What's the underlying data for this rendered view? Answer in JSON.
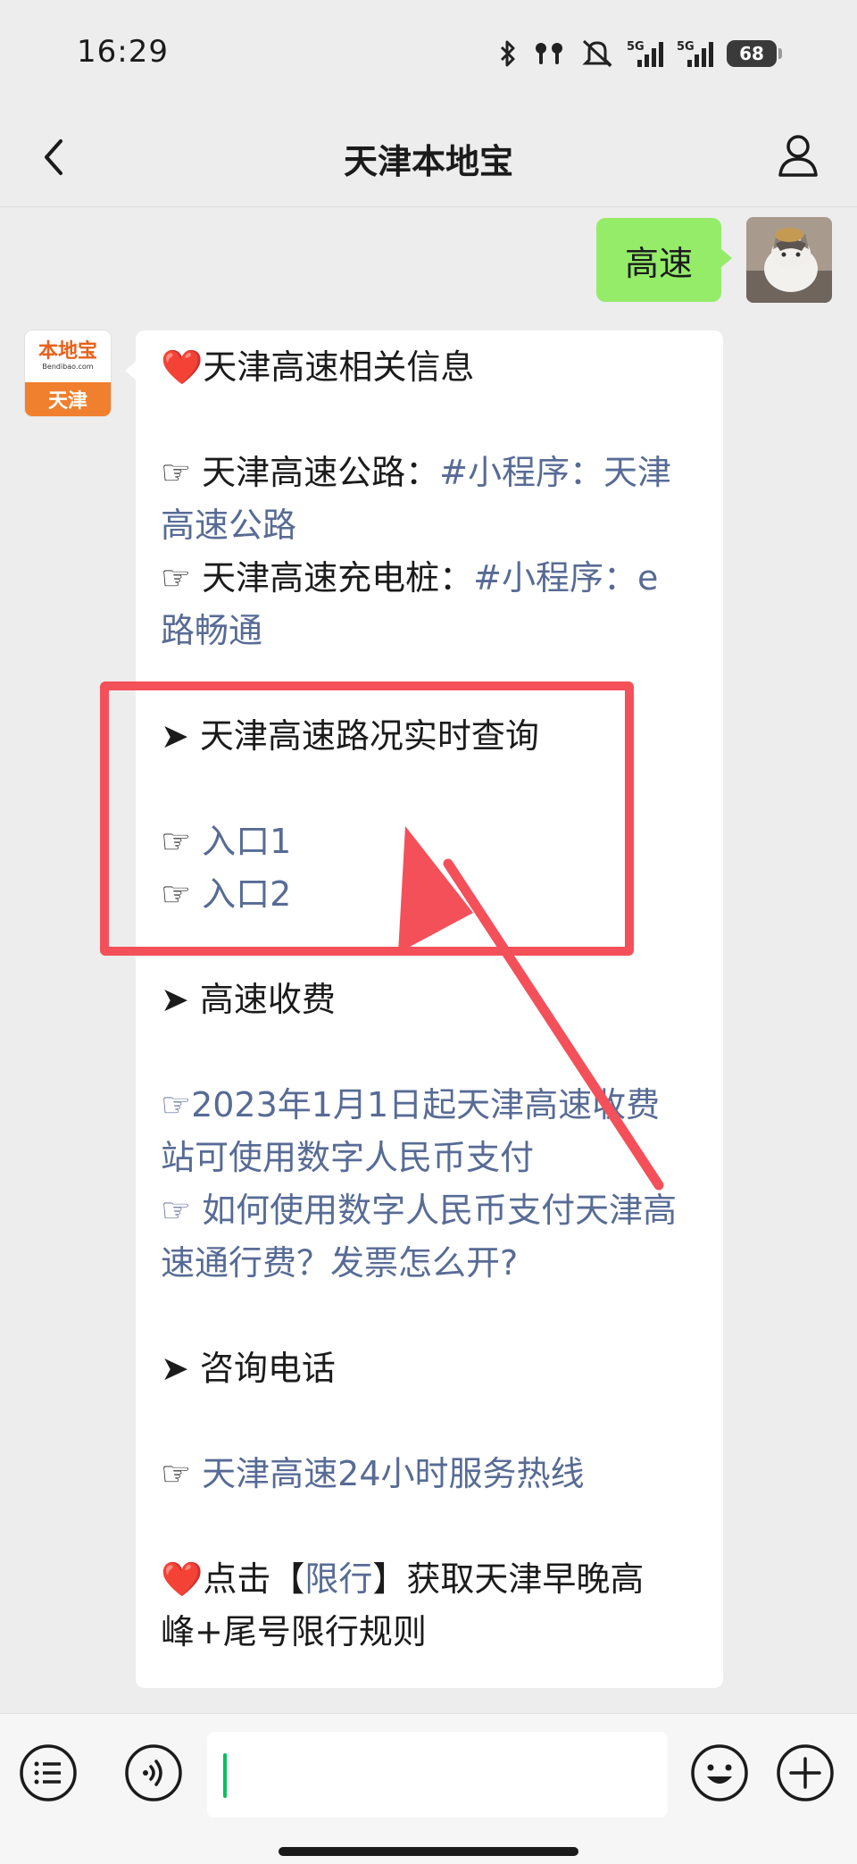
{
  "status_bar": {
    "time": "16:29",
    "signal_1": "5G",
    "signal_2": "5G",
    "battery": "68"
  },
  "nav": {
    "title": "天津本地宝"
  },
  "messages": {
    "outgoing_text": "高速",
    "bot_logo": "本地宝",
    "bot_url": "Bendibao.com",
    "bot_city": "天津"
  },
  "reply": {
    "title_heart": "❤️",
    "title": "天津高速相关信息",
    "road_prefix": "☞ 天津高速公路：",
    "road_link_1": "#小程序：天津",
    "road_link_2": "高速公路",
    "charger_prefix": "☞ 天津高速充电桩：",
    "charger_link_1": "#小程序：e",
    "charger_link_2": "路畅通",
    "section_traffic": "➤ 天津高速路况实时查询",
    "entry_1_icon": "☞",
    "entry_1": "入口1",
    "entry_2_icon": "☞",
    "entry_2": "入口2",
    "section_toll": "➤ 高速收费",
    "toll_link_1a": "☞2023年1月1日起天津高速收费",
    "toll_link_1b": "站可使用数字人民币支付",
    "toll_link_2a": "☞ 如何使用数字人民币支付天津高",
    "toll_link_2b": "速通行费？发票怎么开?",
    "section_phone": "➤ 咨询电话",
    "hotline_icon": "☞",
    "hotline": "天津高速24小时服务热线",
    "footer_heart": "❤️",
    "footer_a": "点击【",
    "footer_link": "限行",
    "footer_b": "】获取天津早晚高",
    "footer_c": "峰+尾号限行规则"
  },
  "colors": {
    "link": "#576b95",
    "outgoing_bubble": "#95ec69",
    "highlight": "#f4505a"
  },
  "icons": [
    "bluetooth-icon",
    "earbuds-icon",
    "mute-icon",
    "signal-icon",
    "battery-icon",
    "back-icon",
    "profile-icon",
    "menu-icon",
    "voice-icon",
    "emoji-icon",
    "plus-icon"
  ]
}
